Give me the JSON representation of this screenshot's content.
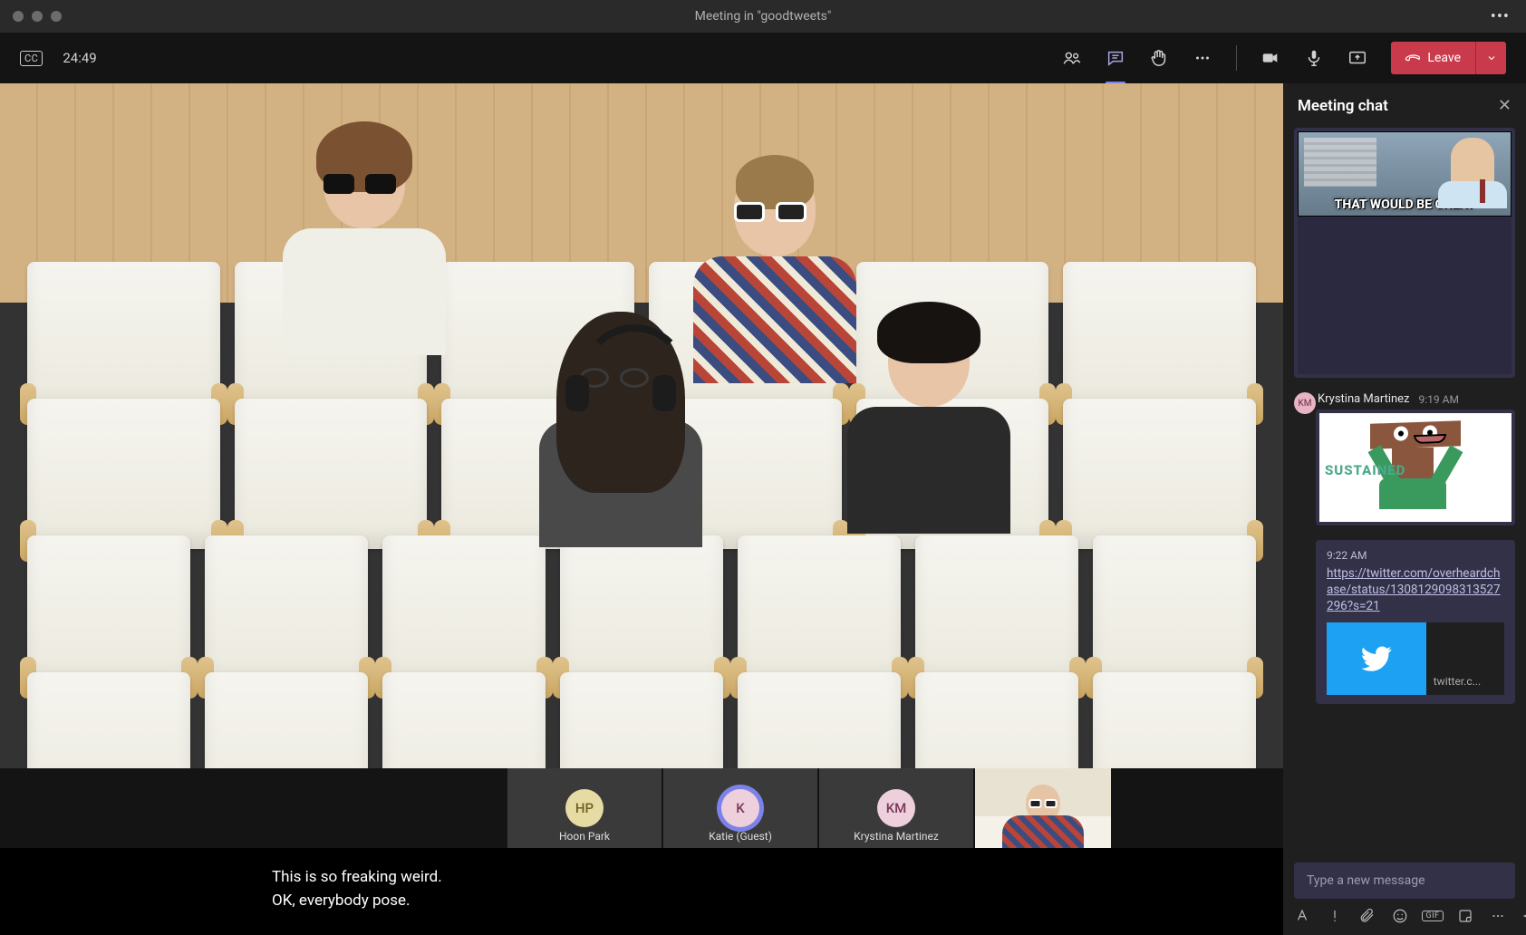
{
  "titlebar": {
    "title": "Meeting in \"goodtweets\""
  },
  "topbar": {
    "timer": "24:49",
    "cc_label": "CC",
    "leave_label": "Leave"
  },
  "roster": [
    {
      "initials": "HP",
      "name": "Hoon Park",
      "bg": "#e7dba4",
      "fg": "#6d5e20",
      "active": false
    },
    {
      "initials": "K",
      "name": "Katie (Guest)",
      "bg": "#eecfdc",
      "fg": "#7a3757",
      "active": true
    },
    {
      "initials": "KM",
      "name": "Krystina Martinez",
      "bg": "#eecfdc",
      "fg": "#7a3757",
      "active": false
    }
  ],
  "captions": [
    "This is so freaking weird.",
    "OK, everybody pose."
  ],
  "chat": {
    "title": "Meeting chat",
    "meme1_text": "THAT WOULD BE GREAT",
    "msg2": {
      "sender": "Krystina Martinez",
      "time": "9:19 AM",
      "initials": "KM",
      "sustained_text": "SUSTAINED"
    },
    "msg3": {
      "time": "9:22 AM",
      "url": "https://twitter.com/overheardchase/status/1308129098313527296?s=21",
      "card_domain": "twitter.c..."
    },
    "compose_placeholder": "Type a new message",
    "gif_label": "GIF"
  }
}
